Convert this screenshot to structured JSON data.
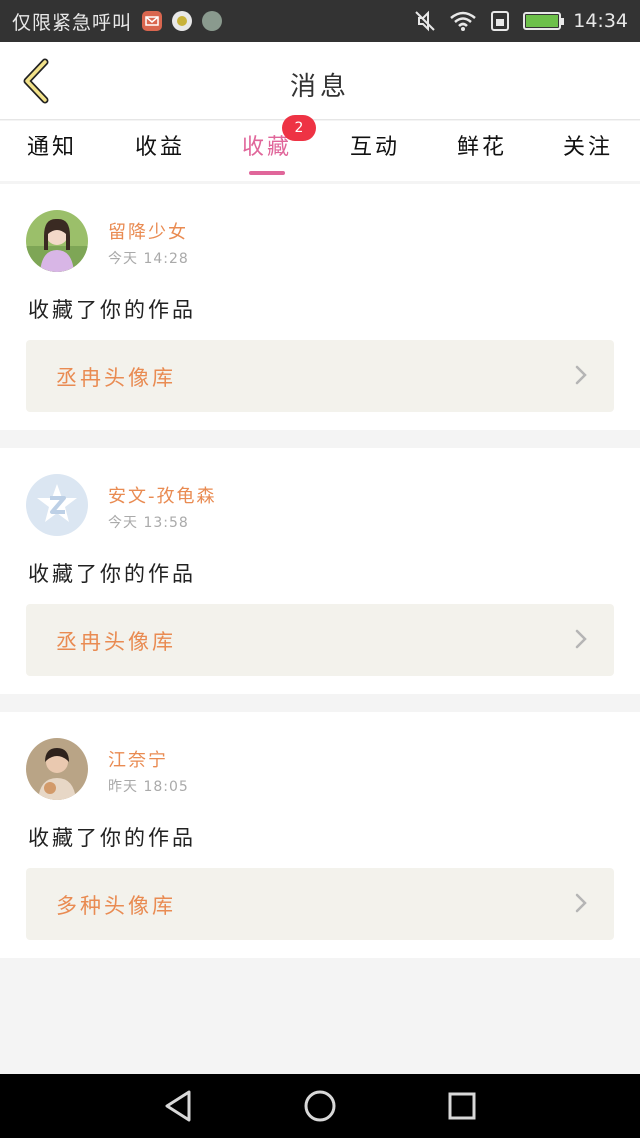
{
  "status_bar": {
    "carrier": "仅限紧急呼叫",
    "apps": [
      "mail-app-icon",
      "chat-app-icon",
      "round-app-icon"
    ],
    "time": "14:34"
  },
  "header": {
    "title": "消息",
    "back_icon": "chevron-left-icon"
  },
  "tabs": [
    {
      "label": "通知",
      "active": false
    },
    {
      "label": "收益",
      "active": false
    },
    {
      "label": "收藏",
      "active": true,
      "badge": "2"
    },
    {
      "label": "互动",
      "active": false
    },
    {
      "label": "鲜花",
      "active": false
    },
    {
      "label": "关注",
      "active": false
    }
  ],
  "messages": [
    {
      "name": "留降少女",
      "time": "今天 14:28",
      "action": "收藏了你的作品",
      "link": "丞冉头像库"
    },
    {
      "name": "安文-孜龟森",
      "time": "今天 13:58",
      "action": "收藏了你的作品",
      "link": "丞冉头像库"
    },
    {
      "name": "江奈宁",
      "time": "昨天 18:05",
      "action": "收藏了你的作品",
      "link": "多种头像库"
    }
  ],
  "colors": {
    "accent": "#e0669a",
    "name": "#e98b52",
    "badge": "#ee3344",
    "link_bg": "#f3f2ec"
  }
}
